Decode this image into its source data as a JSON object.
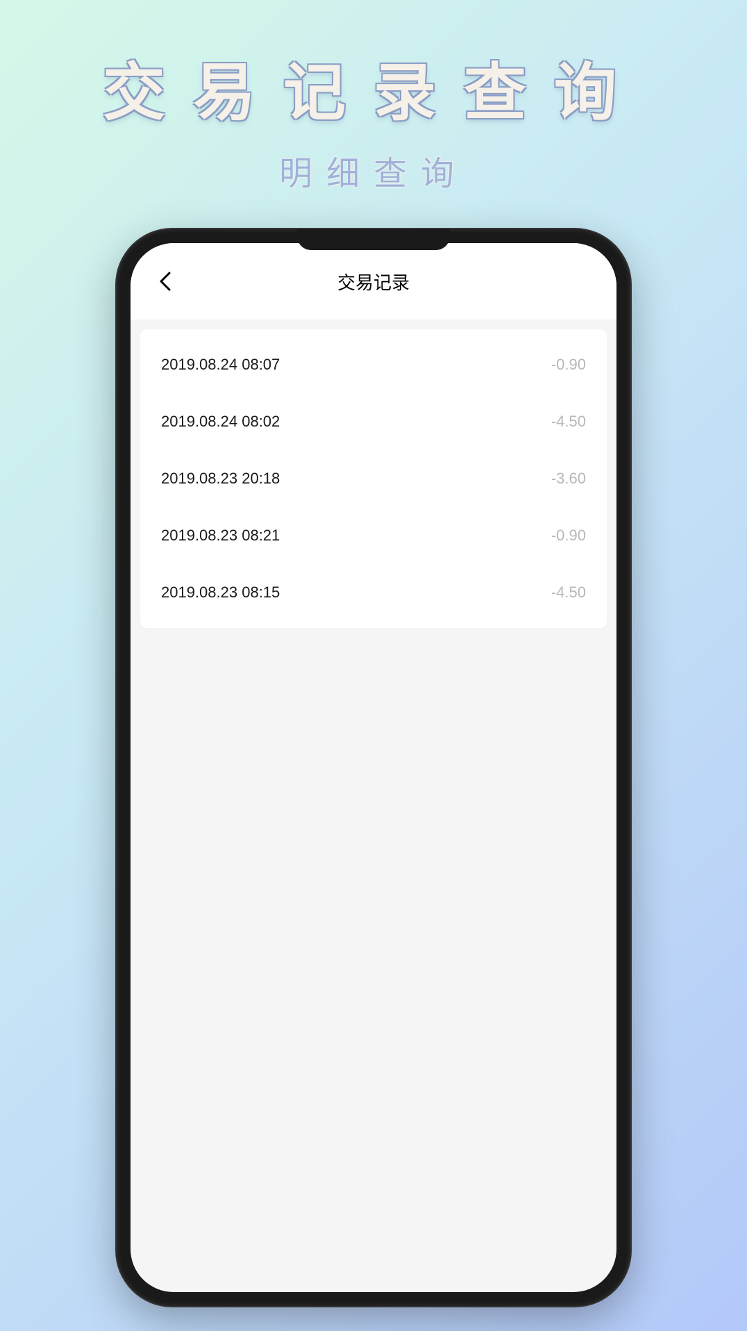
{
  "promo": {
    "title": "交易记录查询",
    "subtitle": "明细查询"
  },
  "header": {
    "title": "交易记录"
  },
  "transactions": [
    {
      "date": "2019.08.24 08:07",
      "amount": "-0.90"
    },
    {
      "date": "2019.08.24 08:02",
      "amount": "-4.50"
    },
    {
      "date": "2019.08.23 20:18",
      "amount": "-3.60"
    },
    {
      "date": "2019.08.23 08:21",
      "amount": "-0.90"
    },
    {
      "date": "2019.08.23 08:15",
      "amount": "-4.50"
    }
  ]
}
